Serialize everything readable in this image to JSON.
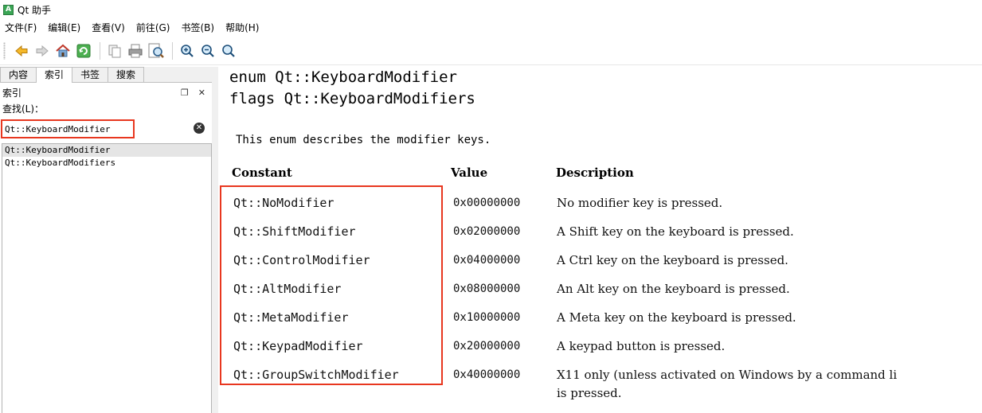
{
  "window": {
    "icon_letter": "A",
    "title": "Qt 助手"
  },
  "menu": [
    "文件(F)",
    "编辑(E)",
    "查看(V)",
    "前往(G)",
    "书签(B)",
    "帮助(H)"
  ],
  "toolbar": {
    "buttons": [
      "back-icon",
      "forward-icon",
      "home-icon",
      "sync-icon",
      "copy-icon",
      "print-icon",
      "find-text-icon",
      "zoom-in-icon",
      "zoom-out-icon",
      "zoom-reset-icon"
    ]
  },
  "sidebar": {
    "tabs": [
      "内容",
      "索引",
      "书签",
      "搜索"
    ],
    "active_tab": "索引",
    "dock_title": "索引",
    "find_label": "查找(L)：",
    "search_value": "Qt::KeyboardModifier",
    "items": [
      "Qt::KeyboardModifier",
      "Qt::KeyboardModifiers"
    ]
  },
  "doc": {
    "heading_enum": "enum Qt::KeyboardModifier",
    "heading_flags": "flags Qt::KeyboardModifiers",
    "description": "This enum describes the modifier keys.",
    "columns": [
      "Constant",
      "Value",
      "Description"
    ],
    "rows": [
      {
        "constant": "Qt::NoModifier",
        "value": "0x00000000",
        "description": "No modifier key is pressed."
      },
      {
        "constant": "Qt::ShiftModifier",
        "value": "0x02000000",
        "description": "A Shift key on the keyboard is pressed."
      },
      {
        "constant": "Qt::ControlModifier",
        "value": "0x04000000",
        "description": "A Ctrl key on the keyboard is pressed."
      },
      {
        "constant": "Qt::AltModifier",
        "value": "0x08000000",
        "description": "An Alt key on the keyboard is pressed."
      },
      {
        "constant": "Qt::MetaModifier",
        "value": "0x10000000",
        "description": "A Meta key on the keyboard is pressed."
      },
      {
        "constant": "Qt::KeypadModifier",
        "value": "0x20000000",
        "description": "A keypad button is pressed."
      },
      {
        "constant": "Qt::GroupSwitchModifier",
        "value": "0x40000000",
        "description": "X11 only (unless activated on Windows by a command li",
        "description_line2": "is pressed."
      }
    ]
  },
  "colors": {
    "highlight": "#e8371f"
  }
}
